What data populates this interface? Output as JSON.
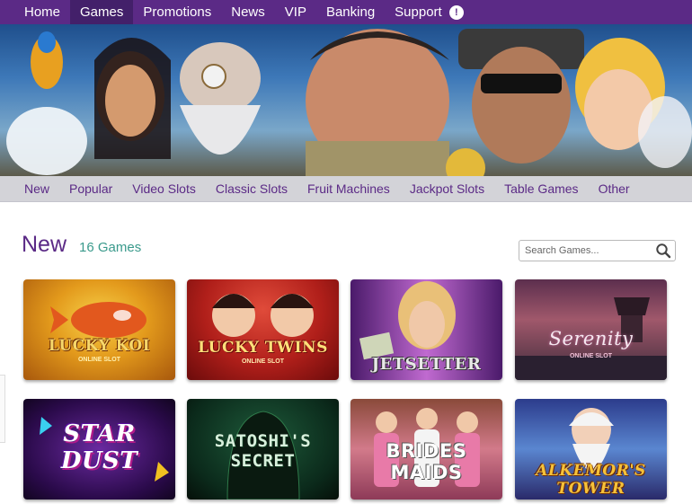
{
  "topnav": {
    "items": [
      "Home",
      "Games",
      "Promotions",
      "News",
      "VIP",
      "Banking",
      "Support"
    ],
    "active": "Games",
    "support_badge": "!"
  },
  "subnav": {
    "items": [
      "New",
      "Popular",
      "Video Slots",
      "Classic Slots",
      "Fruit Machines",
      "Jackpot Slots",
      "Table Games",
      "Other"
    ]
  },
  "section": {
    "title": "New",
    "count": "16 Games"
  },
  "search": {
    "placeholder": "Search Games..."
  },
  "games": [
    {
      "title": "LUCKY KOI",
      "subtitle": "ONLINE SLOT"
    },
    {
      "title": "LUCKY TWINS",
      "subtitle": "ONLINE SLOT"
    },
    {
      "title": "JETSETTER",
      "subtitle": ""
    },
    {
      "title": "Serenity",
      "subtitle": "ONLINE SLOT"
    },
    {
      "title": "STAR DUST",
      "subtitle": ""
    },
    {
      "title": "SATOSHI'S SECRET",
      "subtitle": ""
    },
    {
      "title": "BRIDES MAIDS",
      "subtitle": ""
    },
    {
      "title": "ALKEMOR'S TOWER",
      "subtitle": ""
    }
  ],
  "colors": {
    "brand": "#5b2a86",
    "active_nav": "#43206a",
    "subnav_bg": "#d3d3d8",
    "count_text": "#3a9a8c"
  },
  "icons": {
    "search": "search-icon",
    "support": "alert-icon"
  }
}
